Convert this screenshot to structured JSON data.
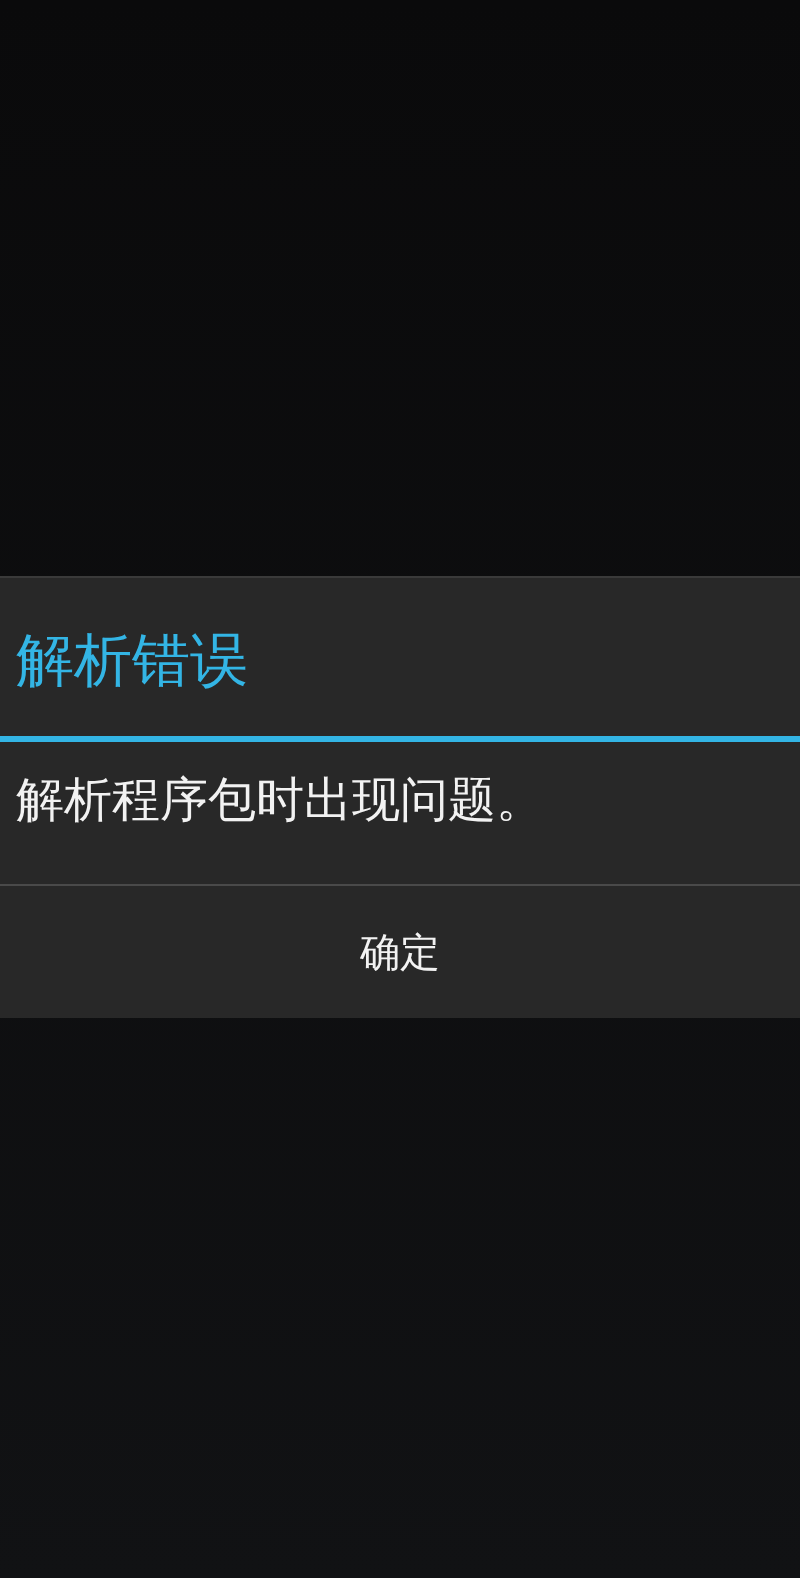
{
  "dialog": {
    "title": "解析错误",
    "message": "解析程序包时出现问题。",
    "buttons": [
      "确定"
    ]
  }
}
